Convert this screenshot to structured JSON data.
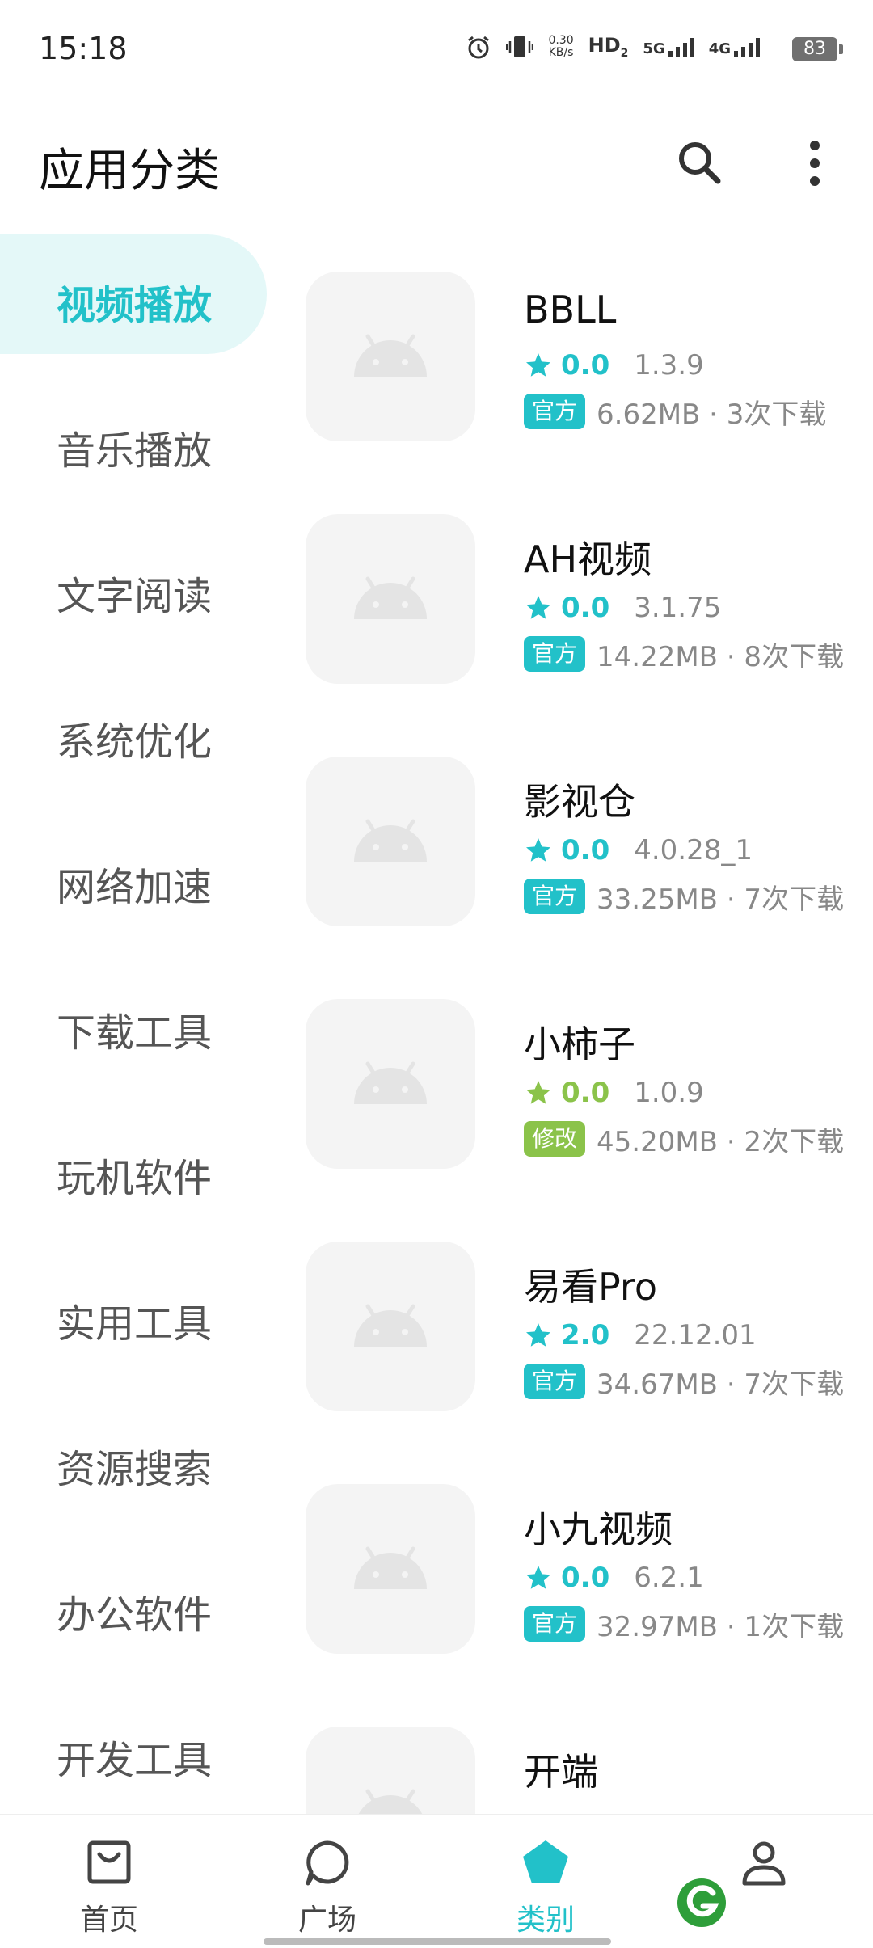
{
  "status_bar": {
    "time": "15:18",
    "net_speed_value": "0.30",
    "net_speed_unit": "KB/s",
    "hd_label": "HD",
    "hd_sub": "2",
    "sim1_label": "5G",
    "sim2_label": "4G",
    "battery": "83",
    "icons": [
      "alarm-icon",
      "vibrate-icon",
      "signal-icon",
      "battery-icon"
    ]
  },
  "header": {
    "title": "应用分类",
    "icons": [
      "search-icon",
      "more-vert-icon"
    ]
  },
  "sidebar": {
    "items": [
      {
        "label": "视频播放",
        "active": true
      },
      {
        "label": "音乐播放",
        "active": false
      },
      {
        "label": "文字阅读",
        "active": false
      },
      {
        "label": "系统优化",
        "active": false
      },
      {
        "label": "网络加速",
        "active": false
      },
      {
        "label": "下载工具",
        "active": false
      },
      {
        "label": "玩机软件",
        "active": false
      },
      {
        "label": "实用工具",
        "active": false
      },
      {
        "label": "资源搜索",
        "active": false
      },
      {
        "label": "办公软件",
        "active": false
      },
      {
        "label": "开发工具",
        "active": false
      }
    ]
  },
  "apps": [
    {
      "name": "BBLL",
      "rating": "0.0",
      "version": "1.3.9",
      "badge": "官方",
      "meta": "6.62MB · 3次下载"
    },
    {
      "name": "AH视频",
      "rating": "0.0",
      "version": "3.1.75",
      "badge": "官方",
      "meta": "14.22MB · 8次下载"
    },
    {
      "name": "影视仓",
      "rating": "0.0",
      "version": "4.0.28_1",
      "badge": "官方",
      "meta": "33.25MB · 7次下载"
    },
    {
      "name": "小柿子",
      "rating": "0.0",
      "version": "1.0.9",
      "badge": "修改",
      "meta": "45.20MB · 2次下载"
    },
    {
      "name": "易看Pro",
      "rating": "2.0",
      "version": "22.12.01",
      "badge": "官方",
      "meta": "34.67MB · 7次下载"
    },
    {
      "name": "小九视频",
      "rating": "0.0",
      "version": "6.2.1",
      "badge": "官方",
      "meta": "32.97MB · 1次下载"
    },
    {
      "name": "开端",
      "rating": "",
      "version": "",
      "badge": "",
      "meta": ""
    }
  ],
  "colors": {
    "accent": "#22c1c9",
    "official_badge": "#22c1c9",
    "modified_badge": "#8bc34a",
    "sidebar_active_bg": "#e4f8f8"
  },
  "bottom_nav": {
    "items": [
      {
        "label": "首页",
        "icon": "home-bag-icon",
        "active": false
      },
      {
        "label": "广场",
        "icon": "chat-bubble-icon",
        "active": false
      },
      {
        "label": "类别",
        "icon": "pentagon-icon",
        "active": true
      },
      {
        "label": "",
        "icon": "profile-icon",
        "active": false
      }
    ]
  }
}
